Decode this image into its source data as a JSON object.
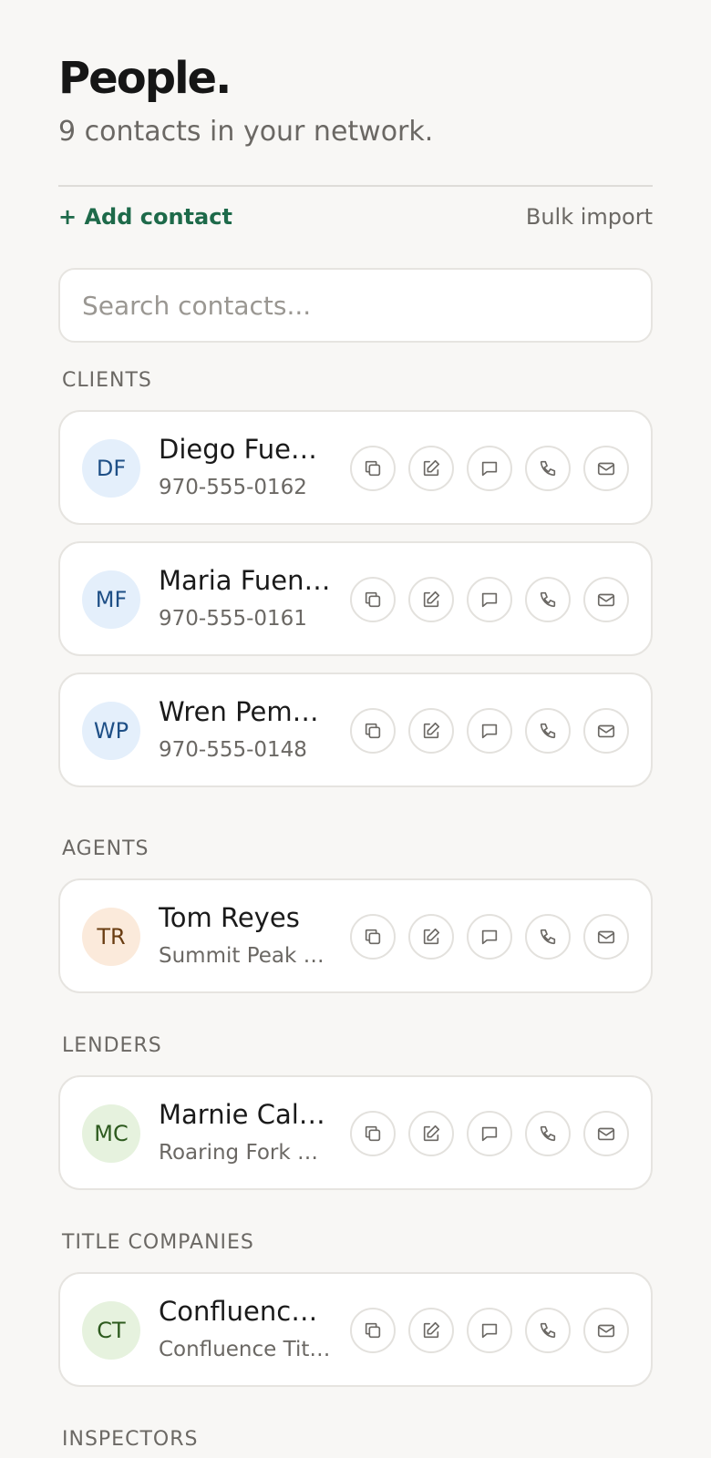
{
  "header": {
    "title": "People.",
    "subtitle": "9 contacts in your network."
  },
  "toolbar": {
    "add_label": "+ Add contact",
    "bulk_label": "Bulk import"
  },
  "search": {
    "placeholder": "Search contacts...",
    "value": ""
  },
  "groups": [
    {
      "label": "CLIENTS",
      "contacts": [
        {
          "initials": "DF",
          "name": "Diego Fuentes",
          "sub": "970-555-0162",
          "avatar_color": "#e4effb"
        },
        {
          "initials": "MF",
          "name": "Maria Fuentes",
          "sub": "970-555-0161",
          "avatar_color": "#e4effb"
        },
        {
          "initials": "WP",
          "name": "Wren Pemberton",
          "sub": "970-555-0148",
          "avatar_color": "#e4effb"
        }
      ]
    },
    {
      "label": "AGENTS",
      "contacts": [
        {
          "initials": "TR",
          "name": "Tom Reyes",
          "sub": "Summit Peak Realty",
          "avatar_color": "#fbeadb"
        }
      ]
    },
    {
      "label": "LENDERS",
      "contacts": [
        {
          "initials": "MC",
          "name": "Marnie Callahan",
          "sub": "Roaring Fork Home Loans",
          "avatar_color": "#e6f2de"
        }
      ]
    },
    {
      "label": "TITLE COMPANIES",
      "contacts": [
        {
          "initials": "CT",
          "name": "Confluence Title",
          "sub": "Confluence Title Co.",
          "avatar_color": "#e6f2de"
        }
      ]
    },
    {
      "label": "INSPECTORS",
      "contacts": []
    }
  ],
  "actions": [
    "copy-icon",
    "edit-icon",
    "message-icon",
    "phone-icon",
    "mail-icon"
  ],
  "colors": {
    "accent": "#1e6a4a",
    "background": "#f8f7f5"
  }
}
